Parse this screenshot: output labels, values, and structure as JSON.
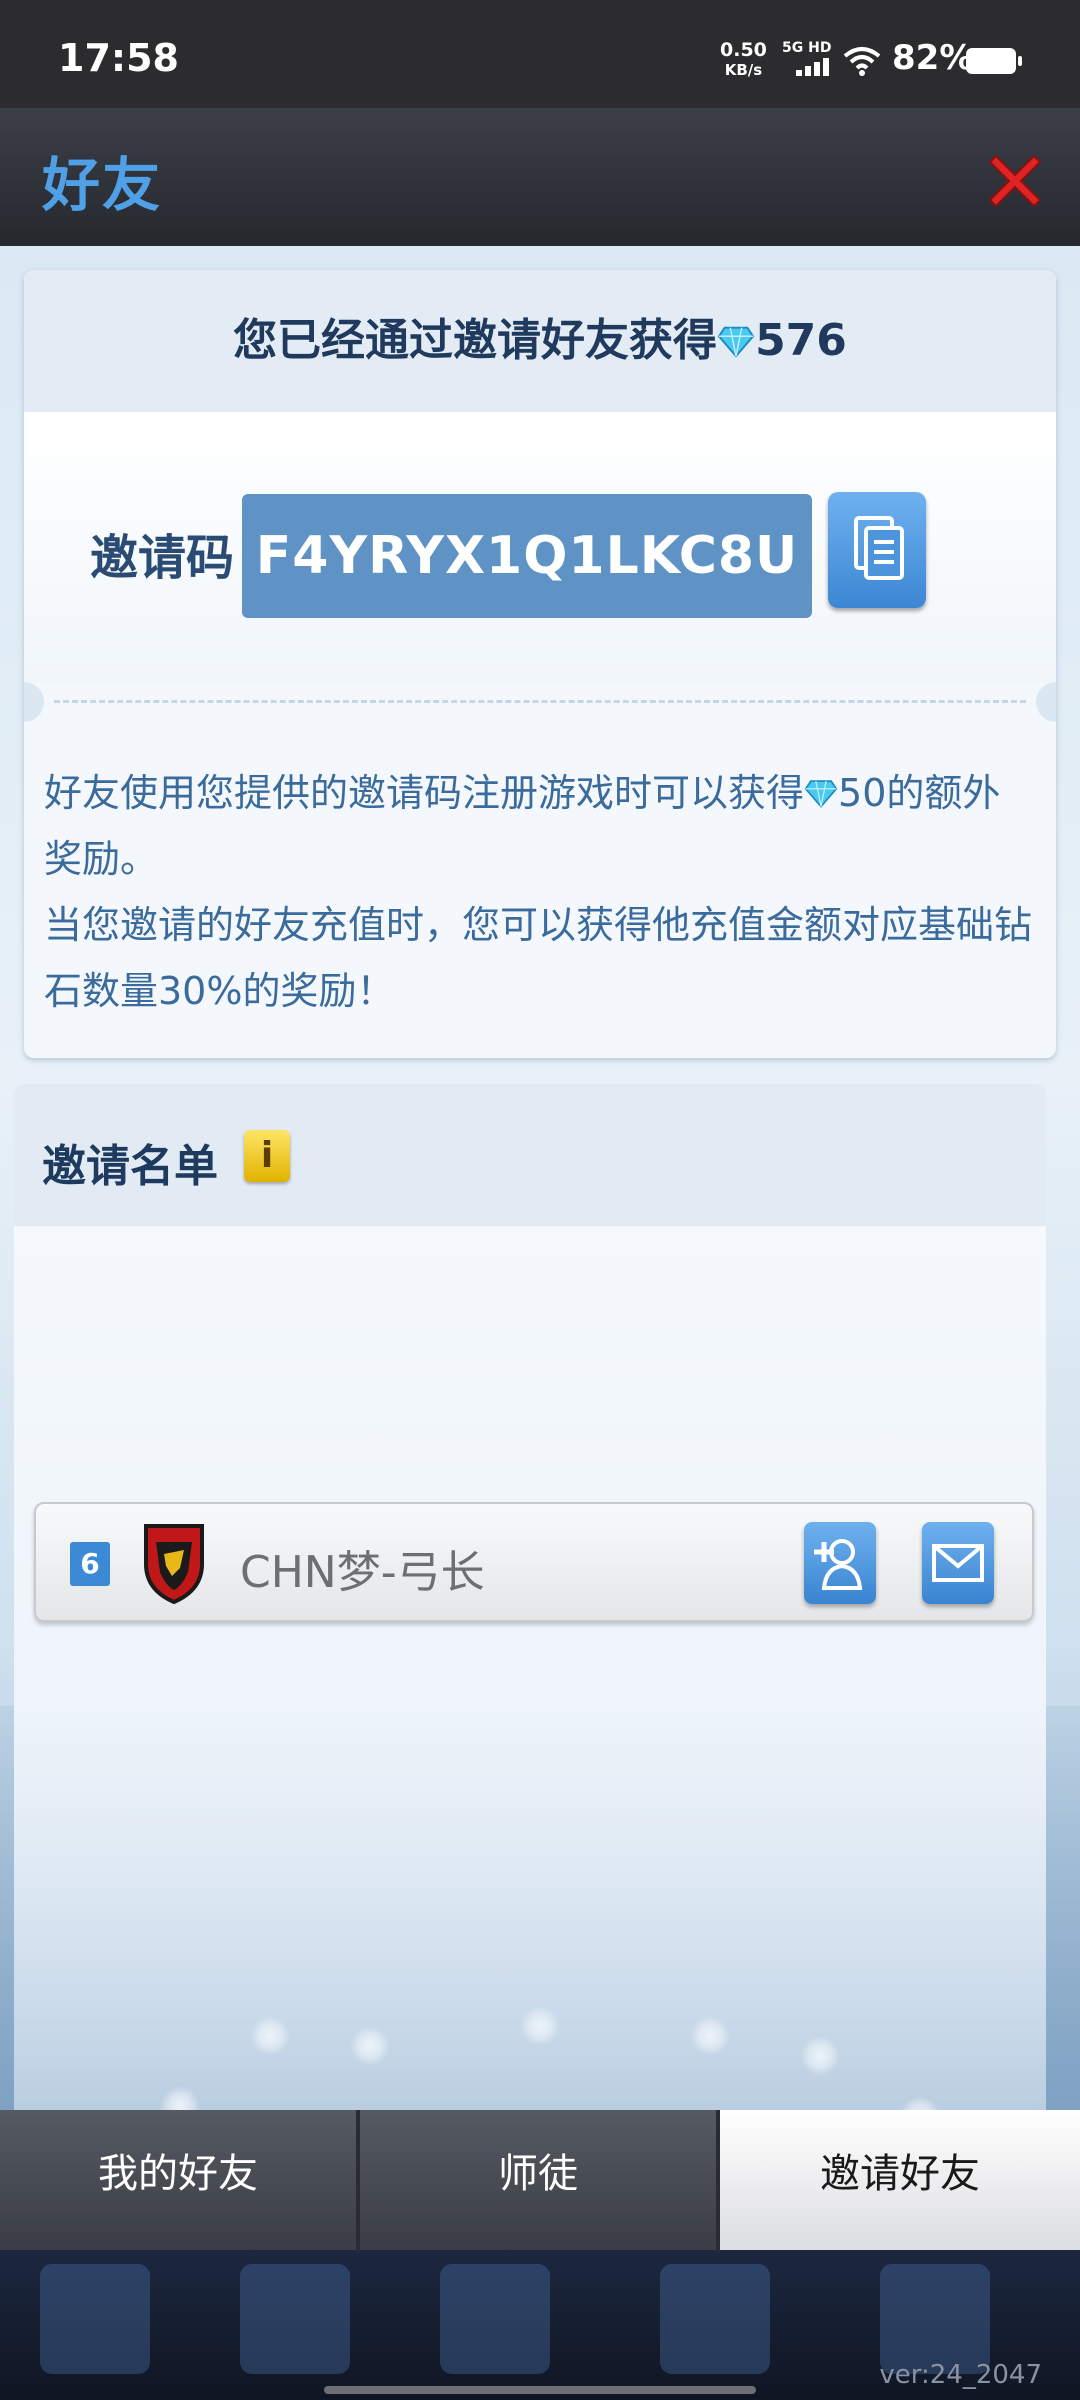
{
  "status_bar": {
    "time": "17:58",
    "net_speed_value": "0.50",
    "net_speed_unit": "KB/s",
    "network": "5G HD",
    "battery": "82%"
  },
  "header": {
    "title": "好友",
    "close_icon": "close-icon"
  },
  "invite_card": {
    "earned_text": "您已经通过邀请好友获得",
    "earned_amount": "576",
    "code_label": "邀请码",
    "code_value": "F4YRYX1Q1LKC8U",
    "copy_icon": "copy-icon",
    "description_line1_a": "好友使用您提供的邀请码注册游戏时可以获得",
    "description_line1_b": "50的额外奖励。",
    "description_line2": "当您邀请的好友充值时，您可以获得他充值金额对应基础钻石数量30%的奖励！"
  },
  "invite_list": {
    "title": "邀请名单",
    "info_icon": "i",
    "friends": [
      {
        "level": "6",
        "name": "CHN梦-弓长"
      }
    ]
  },
  "tabs": [
    {
      "label": "我的好友",
      "active": false
    },
    {
      "label": "师徒",
      "active": false
    },
    {
      "label": "邀请好友",
      "active": true
    }
  ],
  "footer": {
    "version": "ver:24_2047"
  },
  "colors": {
    "accent_blue": "#4fa0e6",
    "code_box": "#5f93c6",
    "button_blue": "#3c87d3",
    "close_red": "#e02424",
    "gem_cyan": "#4cc9f0"
  }
}
